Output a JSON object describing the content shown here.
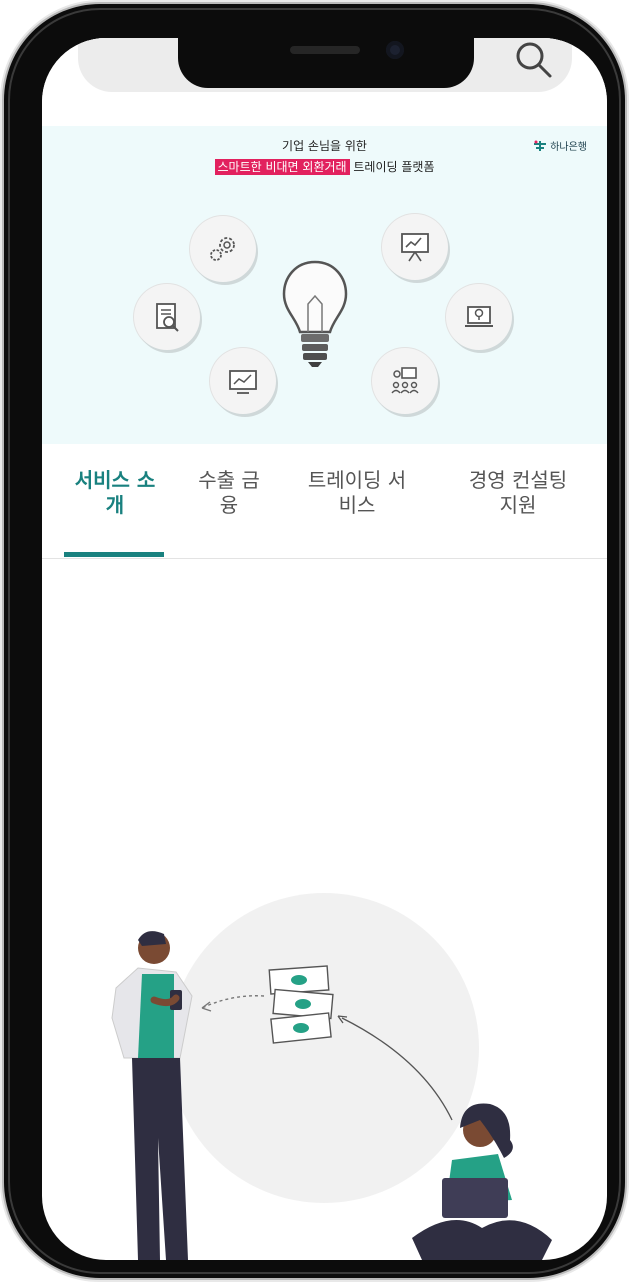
{
  "banner": {
    "title": "기업 손님을 위한",
    "subtitle_highlight": "스마트한 비대면 외환거래",
    "subtitle_rest": " 트레이딩 플랫폼",
    "logo_text": "하나은행",
    "accent_color": "#e2215e"
  },
  "tabs": [
    {
      "line1": "서비스 소",
      "line2": "개",
      "active": true
    },
    {
      "line1": "수출 금",
      "line2": "융",
      "active": false
    },
    {
      "line1": "트레이딩 서",
      "line2": "비스",
      "active": false
    },
    {
      "line1": "경영 컨설팅",
      "line2": "지원",
      "active": false
    }
  ],
  "colors": {
    "brand": "#19817f",
    "banner_bg": "#eefafb",
    "highlight": "#e2215e"
  },
  "icons": [
    "search-icon",
    "gears-icon",
    "presentation-icon",
    "document-search-icon",
    "lightbulb-icon",
    "laptop-idea-icon",
    "chart-screen-icon",
    "team-icon"
  ]
}
